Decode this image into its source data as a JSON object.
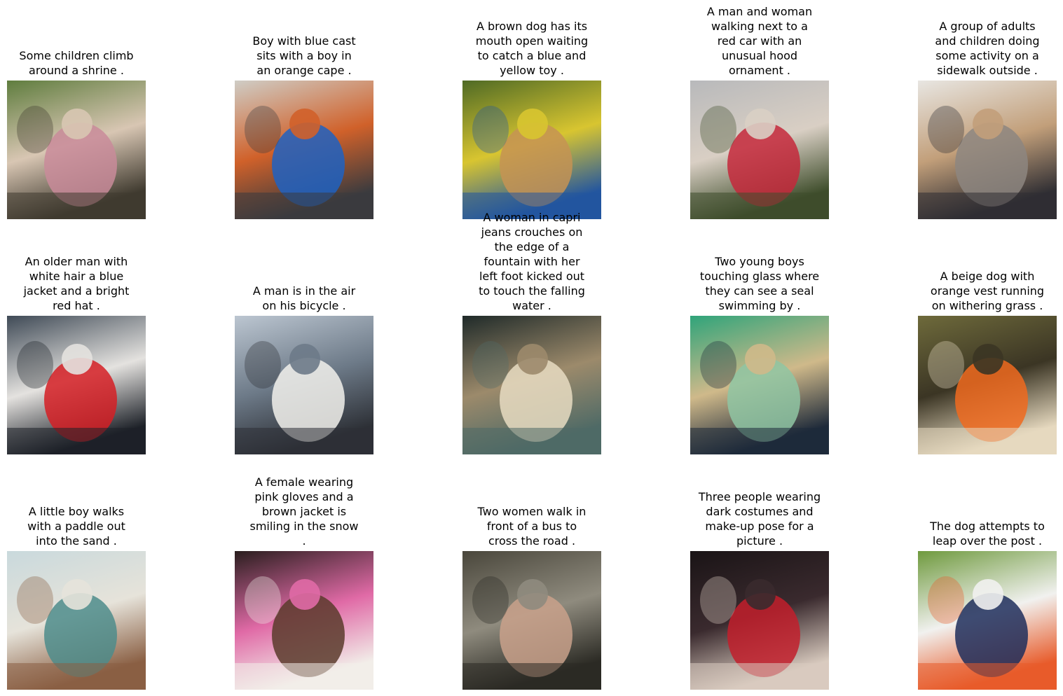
{
  "figure": {
    "items": [
      {
        "caption": "Some children climb\naround a shrine .",
        "subject": "children-shrine-photo",
        "palette": [
          "#5f7d3e",
          "#c98b9a",
          "#3f3a2f",
          "#d8c6b3"
        ]
      },
      {
        "caption": "Boy with blue cast\nsits with a boy in\nan orange cape .",
        "subject": "boys-cast-cape-photo",
        "palette": [
          "#cfcdc6",
          "#1f62c2",
          "#3b3b3e",
          "#d0612a"
        ]
      },
      {
        "caption": "A brown dog has its\nmouth open waiting\nto catch a blue and\nyellow toy .",
        "subject": "dog-catching-toy-photo",
        "palette": [
          "#4f6a25",
          "#c69353",
          "#23569f",
          "#d8c530"
        ]
      },
      {
        "caption": "A man and woman\nwalking next to a\nred car with an\nunusual hood\nornament .",
        "subject": "couple-red-car-photo",
        "palette": [
          "#b8b9bb",
          "#c4283b",
          "#3e4d2b",
          "#d9cfc4"
        ]
      },
      {
        "caption": "A group of adults\nand children doing\nsome activity on a\nsidewalk outside .",
        "subject": "sidewalk-group-photo",
        "palette": [
          "#e8e6e2",
          "#8d8680",
          "#2f2e33",
          "#c29f7a"
        ]
      },
      {
        "caption": "An older man with\nwhite hair a blue\njacket and a bright\nred hat .",
        "subject": "man-red-hat-photo",
        "palette": [
          "#3f4a56",
          "#d51f25",
          "#1d2128",
          "#e4e2df"
        ]
      },
      {
        "caption": "A man is in the air\non his bicycle .",
        "subject": "bmx-jump-photo",
        "palette": [
          "#bcc6d1",
          "#f2f1ec",
          "#2d3036",
          "#6d7a88"
        ]
      },
      {
        "caption": "A woman in capri\njeans crouches on\nthe edge of a\nfountain with her\nleft foot kicked out\nto touch the falling\nwater .",
        "subject": "fountain-woman-photo",
        "palette": [
          "#1f2a29",
          "#e7dcc2",
          "#4f6a66",
          "#9c8a6b"
        ]
      },
      {
        "caption": "Two young boys\ntouching glass where\nthey can see a seal\nswimming by .",
        "subject": "aquarium-seal-photo",
        "palette": [
          "#2fa47a",
          "#8fc5a3",
          "#1e2a3a",
          "#cfb98a"
        ]
      },
      {
        "caption": "A beige dog with\norange vest running\non withering grass .",
        "subject": "dog-orange-vest-photo",
        "palette": [
          "#6e6a3b",
          "#f06a1e",
          "#e6d9bf",
          "#3b3524"
        ]
      },
      {
        "caption": "A little boy walks\nwith a paddle out\ninto the sand .",
        "subject": "boy-paddle-beach-photo",
        "palette": [
          "#c9d9dc",
          "#4d8c8b",
          "#8a5f43",
          "#e6e3da"
        ]
      },
      {
        "caption": "A female wearing\npink gloves and a\nbrown jacket is\nsmiling in the snow\n.",
        "subject": "woman-snow-photo",
        "palette": [
          "#2a1e1e",
          "#5b3b2c",
          "#f2eee9",
          "#e06aa6"
        ]
      },
      {
        "caption": "Two women walk in\nfront of a bus to\ncross the road .",
        "subject": "bus-street-photo",
        "palette": [
          "#4a473c",
          "#c9a18b",
          "#2b2a24",
          "#8f8b7e"
        ]
      },
      {
        "caption": "Three people wearing\ndark costumes and\nmake-up pose for a\npicture .",
        "subject": "costume-trio-photo",
        "palette": [
          "#1a1416",
          "#c21f2b",
          "#d9cbbf",
          "#3a2a2e"
        ]
      },
      {
        "caption": "The dog attempts to\nleap over the post .",
        "subject": "dog-agility-leap-photo",
        "palette": [
          "#6f9a3e",
          "#1e2e5c",
          "#e85b2a",
          "#f1f1ef"
        ]
      }
    ]
  }
}
